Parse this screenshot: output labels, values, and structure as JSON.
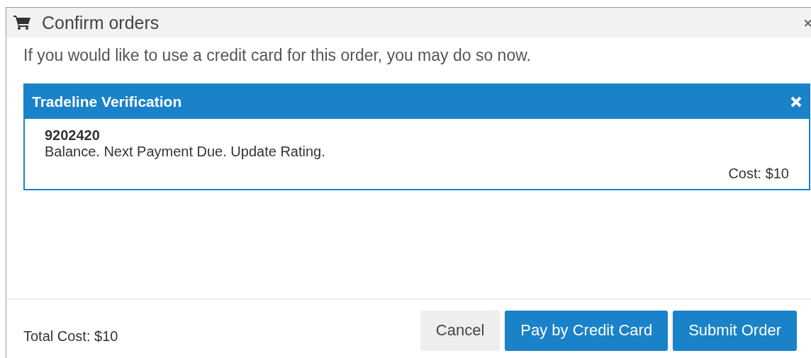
{
  "dialog": {
    "title": "Confirm orders",
    "intro": "If you would like to use a credit card for this order, you may do so now."
  },
  "orders": [
    {
      "title": "Tradeline Verification",
      "number": "9202420",
      "description": "Balance. Next Payment Due. Update Rating.",
      "cost": "Cost: $10"
    }
  ],
  "footer": {
    "total": "Total Cost: $10",
    "buttons": [
      {
        "label": "Cancel",
        "kind": "default"
      },
      {
        "label": "Pay by Credit Card",
        "kind": "primary"
      },
      {
        "label": "Submit Order",
        "kind": "primary"
      }
    ]
  }
}
